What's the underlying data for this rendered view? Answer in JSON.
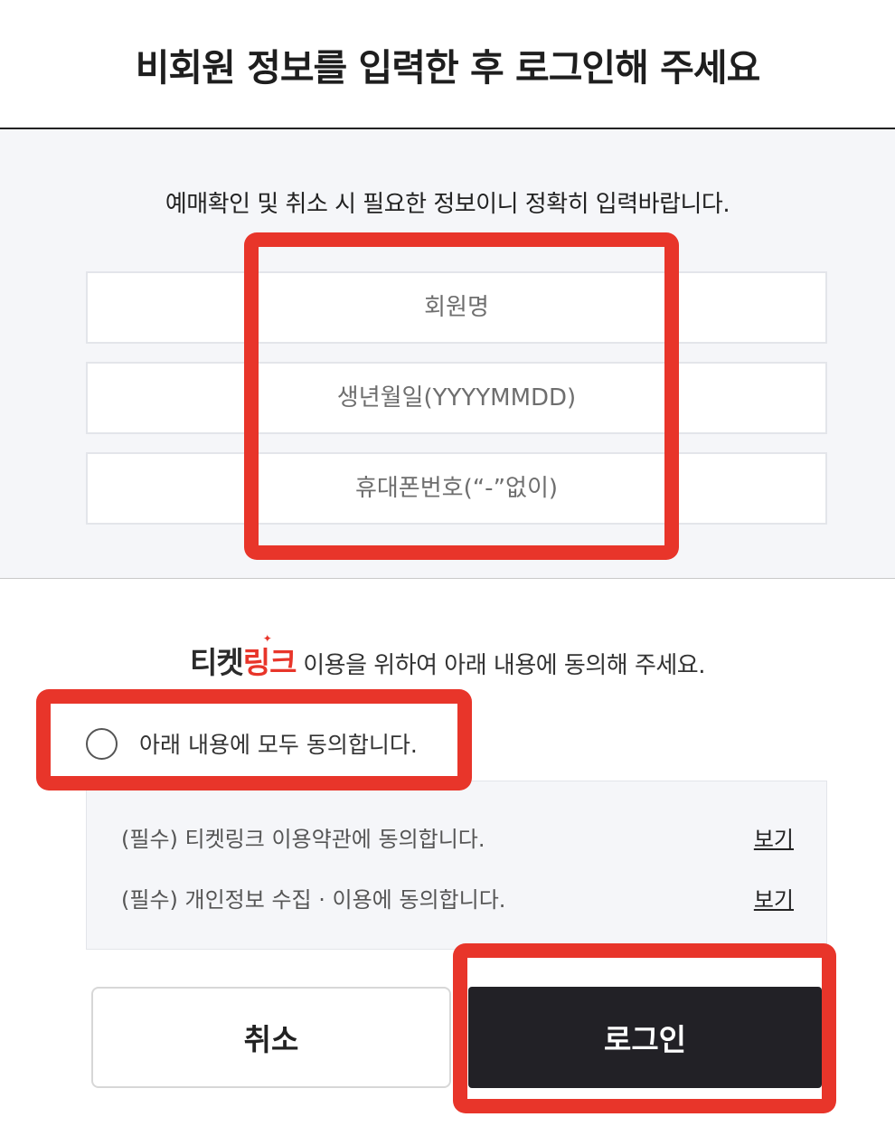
{
  "header": {
    "title": "비회원 정보를 입력한 후 로그인해 주세요"
  },
  "form": {
    "notice": "예매확인 및 취소 시 필요한 정보이니 정확히 입력바랍니다.",
    "name_placeholder": "회원명",
    "birth_placeholder": "생년월일(YYYYMMDD)",
    "phone_placeholder": "휴대폰번호(“-”없이)"
  },
  "agreement": {
    "brand_part1": "티켓",
    "brand_part2": "링크",
    "heading_rest": " 이용을 위하여 아래 내용에 동의해 주세요.",
    "agree_all_label": "아래 내용에 모두 동의합니다.",
    "agree_all_checked": false,
    "terms": [
      {
        "label": "(필수) 티켓링크 이용약관에 동의합니다.",
        "link": "보기"
      },
      {
        "label": "(필수) 개인정보 수집 · 이용에 동의합니다.",
        "link": "보기"
      }
    ]
  },
  "buttons": {
    "cancel": "취소",
    "login": "로그인"
  },
  "colors": {
    "highlight": "#e8352a",
    "login_bg": "#222126",
    "section_bg": "#f5f6f9"
  }
}
